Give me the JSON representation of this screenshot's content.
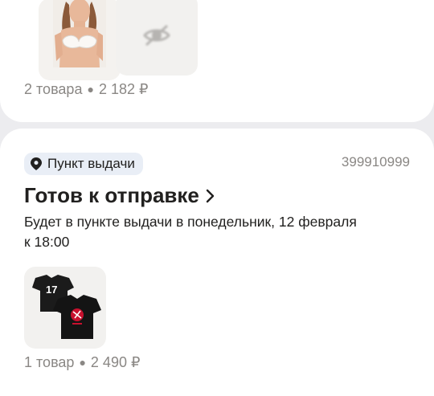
{
  "order1": {
    "summary": {
      "count": "2 товара",
      "price": "2 182 ₽"
    }
  },
  "order2": {
    "pickup_badge": "Пункт выдачи",
    "order_number": "399910999",
    "status_title": "Готов к отправке",
    "delivery_line1": "Будет в пункте выдачи в понедельник, 12 февраля",
    "delivery_line2": "к 18:00",
    "summary": {
      "count": "1 товар",
      "price": "2 490 ₽"
    },
    "jersey_number": "17"
  },
  "icons": {
    "location": "location-pin-icon",
    "hidden": "eye-off-icon",
    "chevron": "chevron-right-icon"
  }
}
